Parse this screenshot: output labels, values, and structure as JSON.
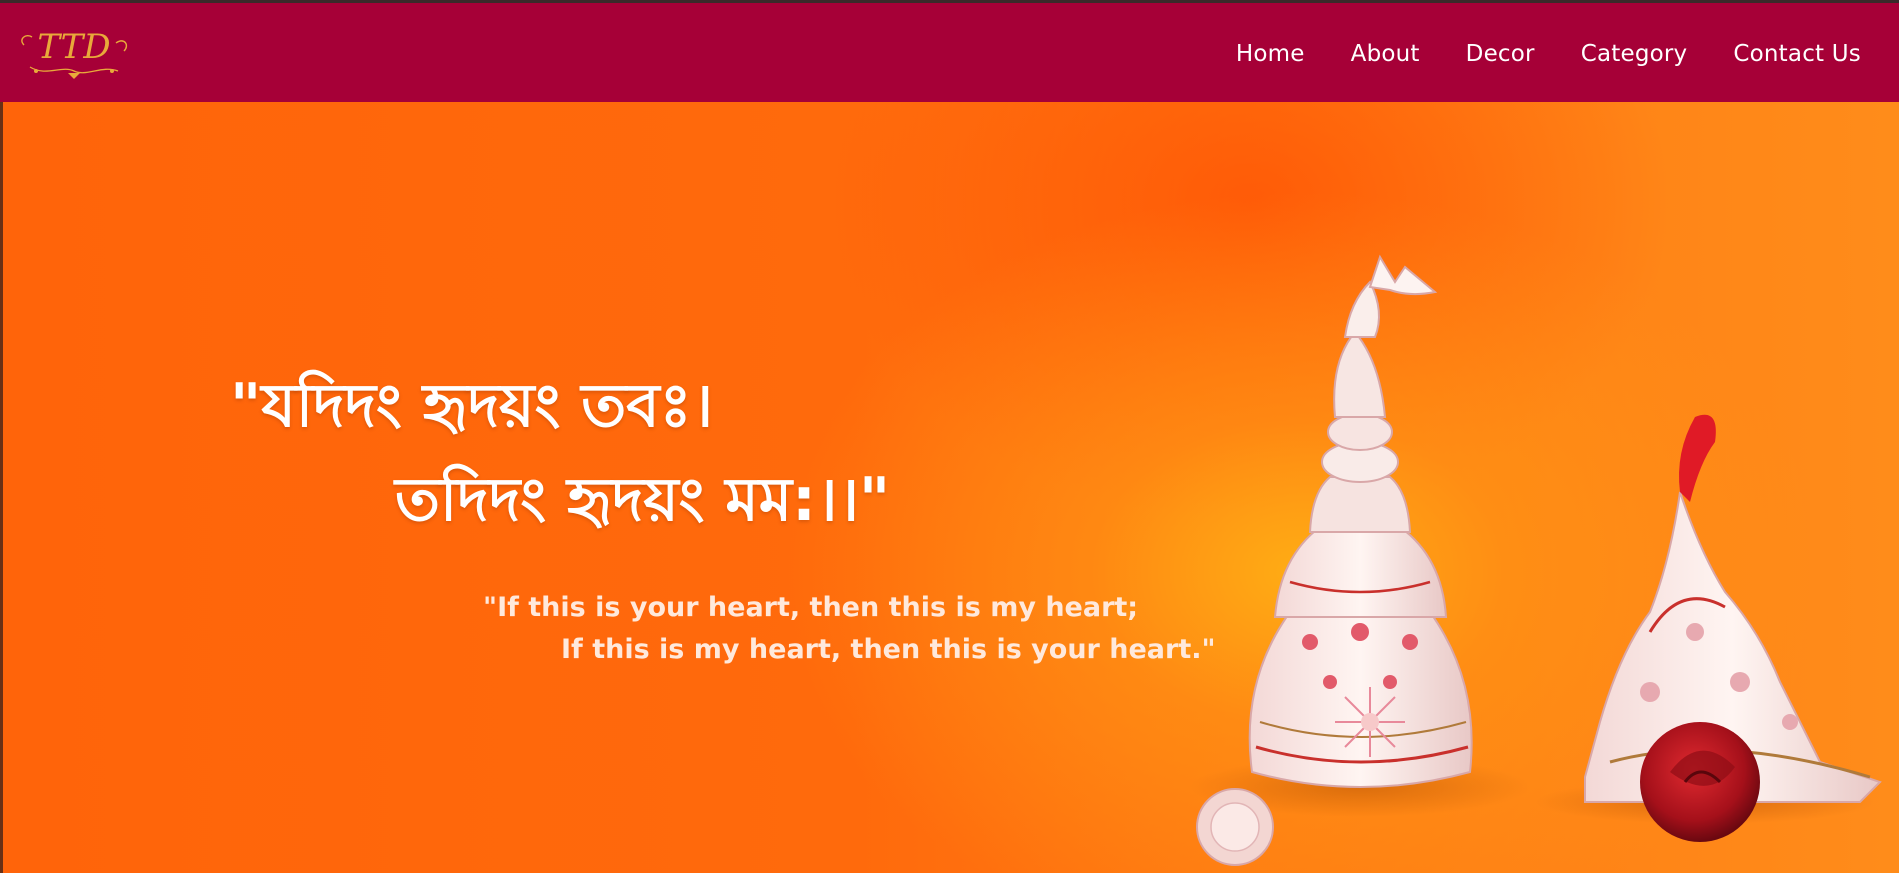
{
  "brand": {
    "logo_text": "TTD"
  },
  "nav": {
    "items": [
      {
        "label": "Home"
      },
      {
        "label": "About"
      },
      {
        "label": "Decor"
      },
      {
        "label": "Category"
      },
      {
        "label": "Contact Us"
      }
    ]
  },
  "hero": {
    "sanskrit_line_1": "\"যদিদং হৃদয়ং তবঃ।",
    "sanskrit_line_2": "তদিদং হৃদয়ং মম:।।\"",
    "translation_line_1": "\"If this is your heart, then this is my heart;",
    "translation_line_2": "If this is my heart, then this is your heart.\""
  },
  "colors": {
    "navbar": "#a60037",
    "hero_orange": "#ff6a0e",
    "logo_gold": "#e8a93a",
    "rose_red": "#b5121b"
  }
}
